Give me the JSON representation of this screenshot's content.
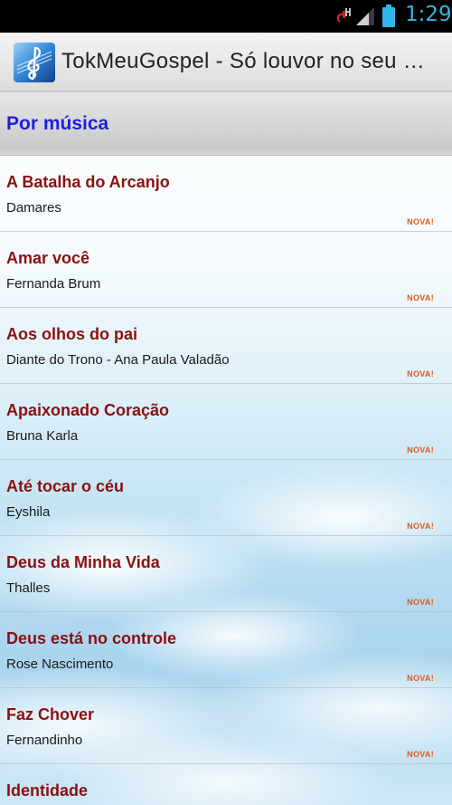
{
  "status_bar": {
    "time": "1:29",
    "icons": [
      "usb-debug-icon",
      "signal-icon",
      "battery-icon"
    ],
    "accent_color": "#33b5e5"
  },
  "action_bar": {
    "title": "TokMeuGospel - Só louvor no seu …",
    "icon": "music-clef-icon"
  },
  "section": {
    "title": "Por música"
  },
  "songs": [
    {
      "title": "A Batalha do Arcanjo",
      "artist": "Damares",
      "badge": "NOVA!"
    },
    {
      "title": "Amar você",
      "artist": "Fernanda Brum",
      "badge": "NOVA!"
    },
    {
      "title": "Aos olhos do pai",
      "artist": "Diante do Trono - Ana Paula Valadão",
      "badge": "NOVA!"
    },
    {
      "title": "Apaixonado Coração",
      "artist": "Bruna Karla",
      "badge": "NOVA!"
    },
    {
      "title": "Até tocar o céu",
      "artist": "Eyshila",
      "badge": "NOVA!"
    },
    {
      "title": "Deus da Minha Vida",
      "artist": "Thalles",
      "badge": "NOVA!"
    },
    {
      "title": "Deus está no controle",
      "artist": "Rose Nascimento",
      "badge": "NOVA!"
    },
    {
      "title": "Faz Chover",
      "artist": "Fernandinho",
      "badge": "NOVA!"
    },
    {
      "title": "Identidade",
      "artist": "",
      "badge": ""
    }
  ],
  "colors": {
    "song_title": "#8b1010",
    "section_title": "#1f1fdc",
    "badge": "#e05a1a"
  }
}
